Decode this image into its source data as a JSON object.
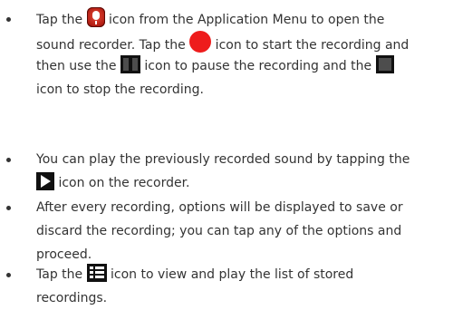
{
  "bullets": [
    {
      "lines": [
        [
          "Tap the ",
          {
            "icon": "app-icon"
          },
          " icon from the Application Menu to open the"
        ],
        [
          "sound recorder. Tap the ",
          {
            "icon": "record-icon"
          },
          " icon to start the recording and"
        ],
        [
          "then use the ",
          {
            "icon": "pause-icon"
          },
          " icon to pause the recording and the ",
          {
            "icon": "stop-icon"
          }
        ],
        [
          "icon to stop the recording."
        ]
      ]
    },
    {
      "lines": [
        [
          "You can play the previously recorded sound by tapping the"
        ],
        [
          {
            "icon": "play-icon"
          },
          " icon on the recorder."
        ]
      ]
    },
    {
      "lines": [
        [
          "After every recording, options will be displayed to save or"
        ],
        [
          "discard the recording; you can tap any of the options and"
        ],
        [
          "proceed."
        ]
      ]
    },
    {
      "lines": [
        [
          "Tap the ",
          {
            "icon": "list-icon"
          },
          " icon to view and play the list of stored"
        ],
        [
          "recordings."
        ]
      ]
    }
  ],
  "colors": {
    "text": "#333333",
    "record": "#ee1c1c"
  }
}
